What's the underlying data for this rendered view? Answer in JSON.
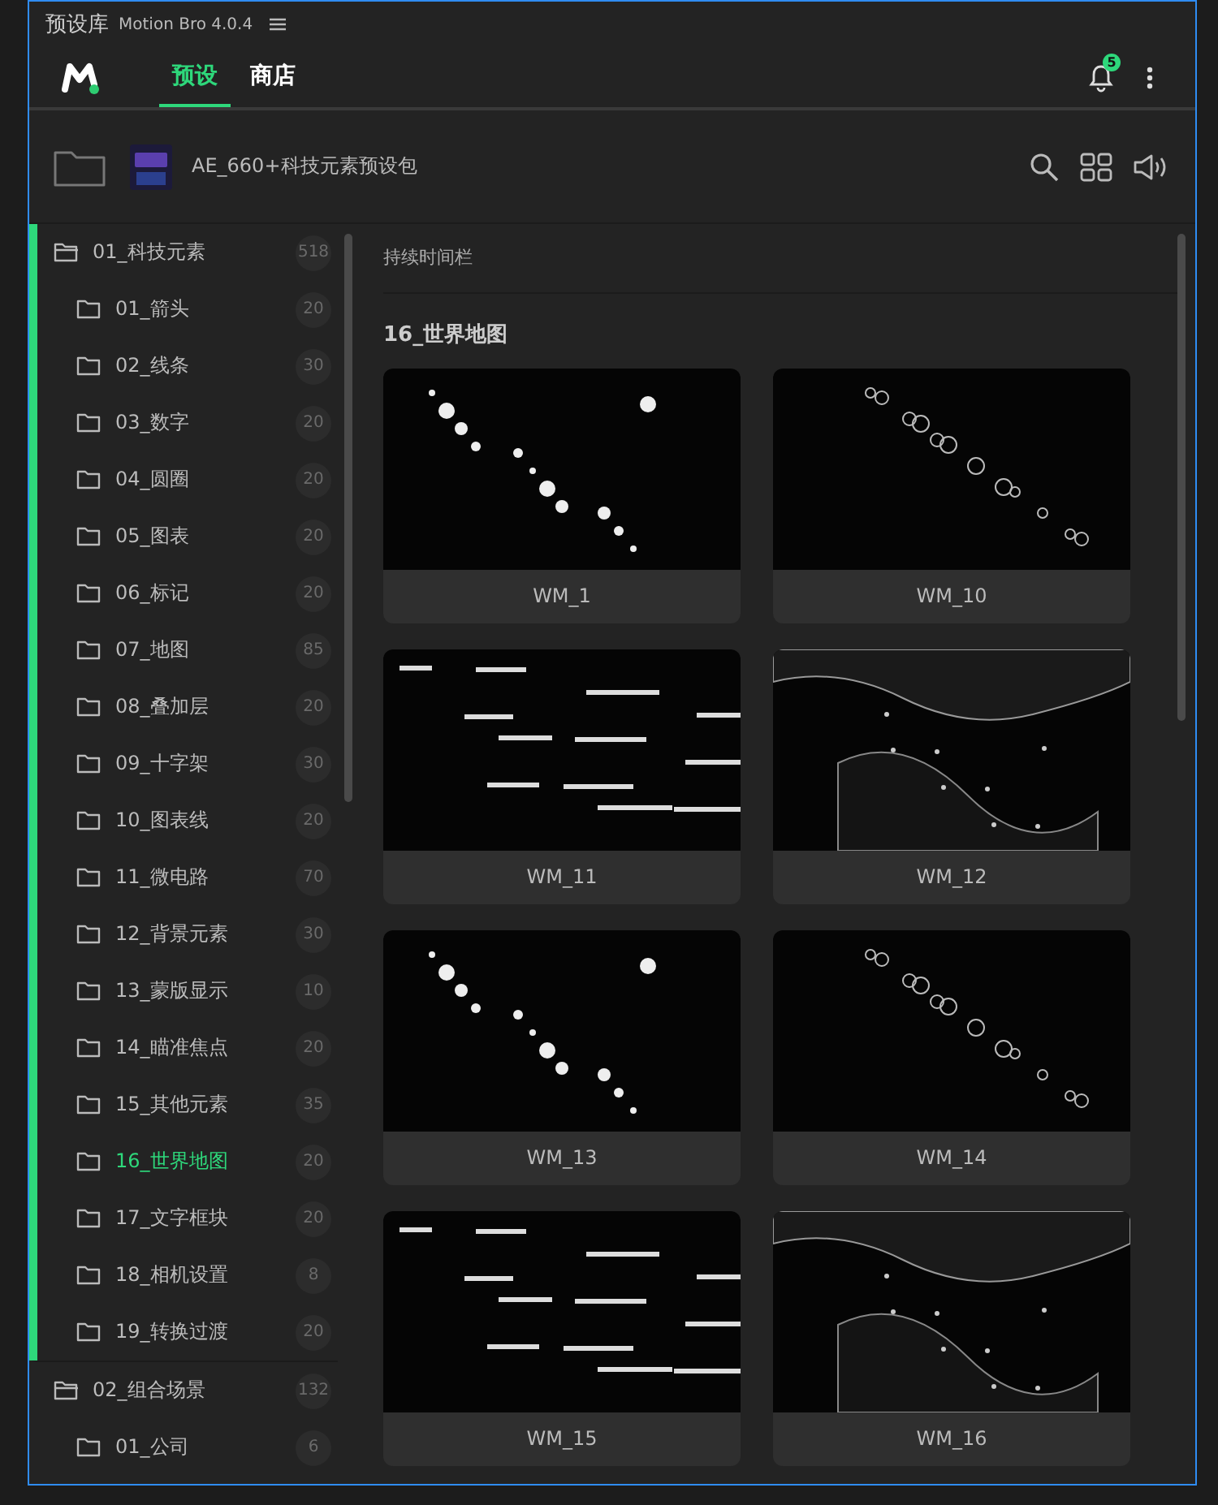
{
  "window": {
    "title": "预设库",
    "subtitle": "Motion Bro 4.0.4"
  },
  "nav": {
    "tabs": [
      {
        "label": "预设",
        "selected": true
      },
      {
        "label": "商店",
        "selected": false
      }
    ],
    "notifications": "5"
  },
  "pack": {
    "name": "AE_660+科技元素预设包"
  },
  "sidebar": {
    "groups": [
      {
        "label": "01_科技元素",
        "count": "518",
        "selected": true,
        "children": [
          {
            "label": "01_箭头",
            "count": "20",
            "selected": false
          },
          {
            "label": "02_线条",
            "count": "30",
            "selected": false
          },
          {
            "label": "03_数字",
            "count": "20",
            "selected": false
          },
          {
            "label": "04_圆圈",
            "count": "20",
            "selected": false
          },
          {
            "label": "05_图表",
            "count": "20",
            "selected": false
          },
          {
            "label": "06_标记",
            "count": "20",
            "selected": false
          },
          {
            "label": "07_地图",
            "count": "85",
            "selected": false
          },
          {
            "label": "08_叠加层",
            "count": "20",
            "selected": false
          },
          {
            "label": "09_十字架",
            "count": "30",
            "selected": false
          },
          {
            "label": "10_图表线",
            "count": "20",
            "selected": false
          },
          {
            "label": "11_微电路",
            "count": "70",
            "selected": false
          },
          {
            "label": "12_背景元素",
            "count": "30",
            "selected": false
          },
          {
            "label": "13_蒙版显示",
            "count": "10",
            "selected": false
          },
          {
            "label": "14_瞄准焦点",
            "count": "20",
            "selected": false
          },
          {
            "label": "15_其他元素",
            "count": "35",
            "selected": false
          },
          {
            "label": "16_世界地图",
            "count": "20",
            "selected": true
          },
          {
            "label": "17_文字框块",
            "count": "20",
            "selected": false
          },
          {
            "label": "18_相机设置",
            "count": "8",
            "selected": false
          },
          {
            "label": "19_转换过渡",
            "count": "20",
            "selected": false
          }
        ]
      },
      {
        "label": "02_组合场景",
        "count": "132",
        "selected": false,
        "children": [
          {
            "label": "01_公司",
            "count": "6",
            "selected": false
          }
        ]
      }
    ]
  },
  "content": {
    "filter_label": "持续时间栏",
    "section_title": "16_世界地图",
    "presets": [
      {
        "name": "WM_1"
      },
      {
        "name": "WM_10"
      },
      {
        "name": "WM_11"
      },
      {
        "name": "WM_12"
      },
      {
        "name": "WM_13"
      },
      {
        "name": "WM_14"
      },
      {
        "name": "WM_15"
      },
      {
        "name": "WM_16"
      }
    ]
  }
}
